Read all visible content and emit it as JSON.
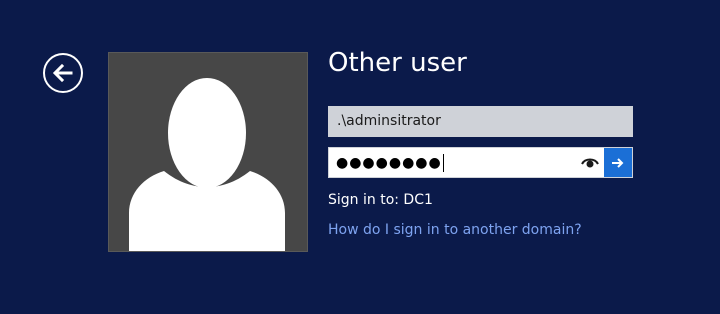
{
  "page": {
    "title": "Other user"
  },
  "colors": {
    "background": "#0b1a4a",
    "avatar_background": "#474747",
    "username_field_background": "#cfd2d8",
    "submit_button": "#1b6fd6",
    "link": "#7ea3f0"
  },
  "icons": {
    "back": "back-arrow-icon",
    "avatar": "user-silhouette-icon",
    "reveal_password": "eye-icon",
    "submit": "arrow-right-icon"
  },
  "form": {
    "username_value": ".\\adminsitrator",
    "password_masked": "●●●●●●●●"
  },
  "sign_in_to": {
    "text": "Sign in to: DC1"
  },
  "links": {
    "domain_help": "How do I sign in to another domain?"
  }
}
